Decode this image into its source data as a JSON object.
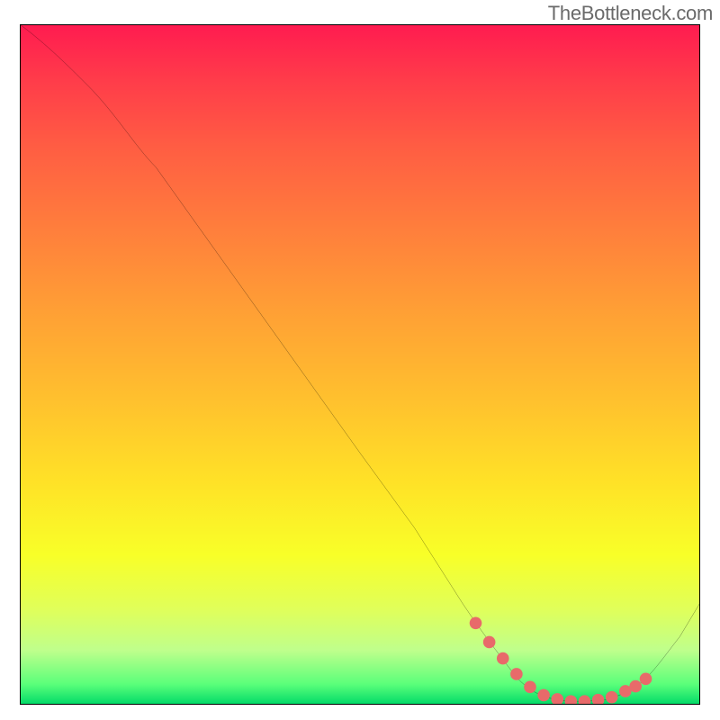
{
  "attribution": "TheBottleneck.com",
  "chart_data": {
    "type": "line",
    "title": "",
    "xlabel": "",
    "ylabel": "",
    "xlim": [
      0,
      100
    ],
    "ylim": [
      0,
      100
    ],
    "grid": false,
    "legend": false,
    "annotations": [
      "TheBottleneck.com"
    ],
    "background": "vertical gradient red→orange→yellow→green",
    "series": [
      {
        "name": "curve",
        "color": "#000000",
        "x": [
          0,
          3,
          8,
          12,
          20,
          30,
          40,
          50,
          58,
          65,
          70,
          73,
          76,
          79,
          82,
          85,
          88,
          91,
          94,
          97,
          100
        ],
        "y": [
          100,
          98,
          94,
          90,
          79,
          65,
          51,
          37,
          26,
          15,
          8,
          4,
          1.5,
          0.7,
          0.5,
          0.6,
          1.2,
          3,
          6,
          10,
          15
        ]
      },
      {
        "name": "highlight",
        "color": "#e86a6a",
        "type": "scatter",
        "x": [
          67,
          70,
          72.5,
          75,
          77.5,
          80,
          82.5,
          85,
          87.5,
          90,
          91.5
        ],
        "y": [
          12,
          8,
          5,
          3,
          1.6,
          0.9,
          0.5,
          0.6,
          1.2,
          2.5,
          4
        ]
      }
    ]
  }
}
